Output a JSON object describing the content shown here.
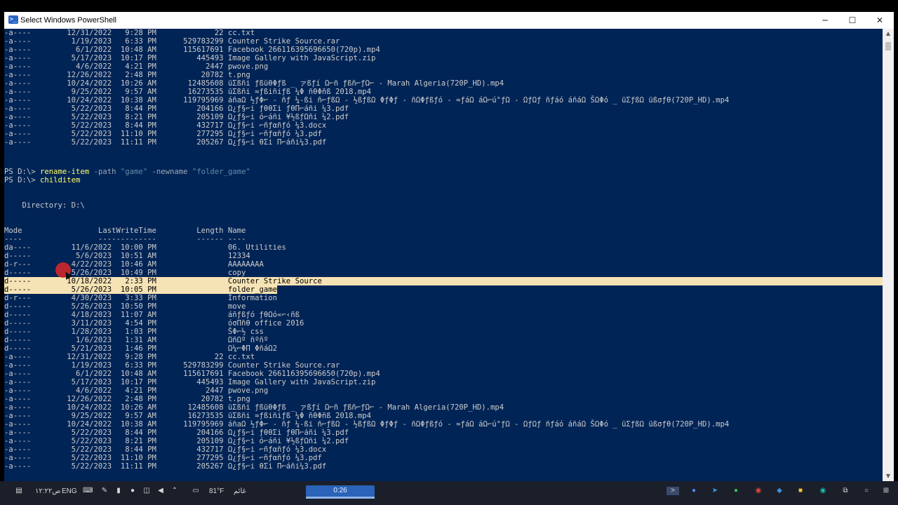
{
  "window": {
    "title": "Select Windows PowerShell",
    "minimize_glyph": "─",
    "maximize_glyph": "☐",
    "close_glyph": "✕",
    "icon": "powershell-icon"
  },
  "colors": {
    "terminal_bg": "#012456",
    "terminal_fg": "#cccccc",
    "command": "#ffff66",
    "selection": "#f6e3b5"
  },
  "terminal": {
    "listing_top": [
      "-a----        12/31/2022   9:28 PM             22 cc.txt",
      "-a----         1/19/2023   6:33 PM      529783299 Counter Strike Source.rar",
      "-a----          6/1/2022  10:48 AM      115617691 Facebook 266116395696650(720p).mp4",
      "-a----         5/17/2023  10:17 PM         445493 Image Gallery with JavaScript.zip",
      "-a----          4/6/2022   4:21 PM           2447 pwove.png",
      "-a----        12/26/2022   2:48 PM          20782 t.png",
      "-a----        10/24/2022  10:26 AM       12485608 üΣßñi ƒßüθΦƒß _ ァßƒí Ω⌐ñ ƒßñ⌐ƒΩ⌐ - Marah Algeria(720P_HD).mp4",
      "-a----         9/25/2022   9:57 AM       16273535 üΣßñi ≈ƒßiñiƒß ¼Φ ñθΦñß 2018.mp4",
      "-a----        10/24/2022  10:38 AM      119795969 áñaΩ ½ƒΦ⌐ - ñƒ ¼-ßi ñ⌐ƒßΩ - ½ßƒßΩ ΦƒΦƒ - ñΩΦƒßƒó - ≈ƒáΩ áΩ⌐ú°ƒΩ - ΩƒΩƒ ñƒáó áñáΩ ŠΩΦó _ üΣƒßΩ üßσƒθ(720P_HD).mp4",
      "-a----         5/22/2023   8:44 PM         204166 Ω¿ƒ§⌐i ƒθθΣi ƒθΠ⌐áñi ¼3.pdf",
      "-a----         5/22/2023   8:21 PM         205109 Ω¿ƒ§⌐i ó⌐áñi ¥½ßƒΩñi ¼2.pdf",
      "-a----         5/22/2023   8:44 PM         432717 Ω¿ƒ§⌐i ⌐ñƒαñƒó ¼3.docx",
      "-a----         5/22/2023  11:10 PM         277295 Ω¿ƒ§⌐i ⌐ñƒαñƒó ¼3.pdf",
      "-a----         5/22/2023  11:11 PM         205267 Ω¿ƒ§⌐i θΣi Π⌐áñi¼3.pdf"
    ],
    "command1": {
      "prompt": "PS D:\\> ",
      "cmdlet": "rename-item",
      "p1": " -path ",
      "v1": "\"game\"",
      "p2": " -newname ",
      "v2": "\"folder_game\""
    },
    "command2": {
      "prompt": "PS D:\\> ",
      "cmdlet": "childitem"
    },
    "directory": "    Directory: D:\\",
    "header": "Mode                 LastWriteTime         Length Name",
    "underline": "----                 -------------         ------ ----",
    "listing_bottom": [
      "da----         11/6/2022  10:00 PM                06. Utilities",
      "d-----          5/6/2023  10:51 AM                12334",
      "d-r---         4/22/2023  10:46 AM                AAAAAAAA",
      "d-----         5/26/2023  10:49 PM                copy",
      "d-----        10/18/2022   2:33 PM                Counter Strike Source",
      "d-----         5/26/2023  10:05 PM                folder_game",
      "d-r---         4/30/2023   3:33 PM                Information",
      "d-----         5/26/2023  10:50 PM                move",
      "d-----         4/18/2023  11:07 AM                áñƒßƒó ƒθΩó«⌐‹ñß",
      "d-----         3/11/2023   4:54 PM                óσΠñθ office 2016",
      "d-----         1/28/2023   1:03 PM                ŠΦ⌐½ css",
      "d-----          1/6/2023   1:31 AM                ΩñΩº ñºñº",
      "d-----         5/21/2023   1:46 PM                Ω¼⌐ΦΠ ΦñáΩ2",
      "-a----        12/31/2022   9:28 PM             22 cc.txt",
      "-a----         1/19/2023   6:33 PM      529783299 Counter Strike Source.rar",
      "-a----          6/1/2022  10:48 AM      115617691 Facebook 266116395696650(720p).mp4",
      "-a----         5/17/2023  10:17 PM         445493 Image Gallery with JavaScript.zip",
      "-a----          4/6/2022   4:21 PM           2447 pwove.png",
      "-a----        12/26/2022   2:48 PM          20782 t.png",
      "-a----        10/24/2022  10:26 AM       12485608 üΣßñi ƒßüθΦƒß _ ァßƒí Ω⌐ñ ƒßñ⌐ƒΩ⌐ - Marah Algeria(720P_HD).mp4",
      "-a----         9/25/2022   9:57 AM       16273535 üΣßñi ≈ƒßiñiƒß ¼Φ ñθΦñß 2018.mp4",
      "-a----        10/24/2022  10:38 AM      119795969 áñaΩ ½ƒΦ⌐ - ñƒ ¼-ßi ñ⌐ƒßΩ - ½ßƒßΩ ΦƒΦƒ - ñΩΦƒßƒó - ≈ƒáΩ áΩ⌐ú°ƒΩ - ΩƒΩƒ ñƒáó áñáΩ ŠΩΦó _ üΣƒßΩ üßσƒθ(720P_HD).mp4",
      "-a----         5/22/2023   8:44 PM         204166 Ω¿ƒ§⌐i ƒθθΣi ƒθΠ⌐áñi ¼3.pdf",
      "-a----         5/22/2023   8:21 PM         205109 Ω¿ƒ§⌐i ó⌐áñi ¥½ßƒΩñi ¼2.pdf",
      "-a----         5/22/2023   8:44 PM         432717 Ω¿ƒ§⌐i ⌐ñƒαñƒó ¼3.docx",
      "-a----         5/22/2023  11:10 PM         277295 Ω¿ƒ§⌐i ⌐ñƒαñƒó ¼3.pdf",
      "-a----         5/22/2023  11:11 PM         205267 Ω¿ƒ§⌐i θΣi Π⌐áñi¼3.pdf"
    ],
    "highlighted_rows": [
      4,
      5
    ]
  },
  "taskbar": {
    "lang": "ENG",
    "temp": "81°F",
    "time_rtl": "ص١٢:٢٢",
    "weather_rtl": "غائم",
    "recording_timer": "0:26"
  }
}
